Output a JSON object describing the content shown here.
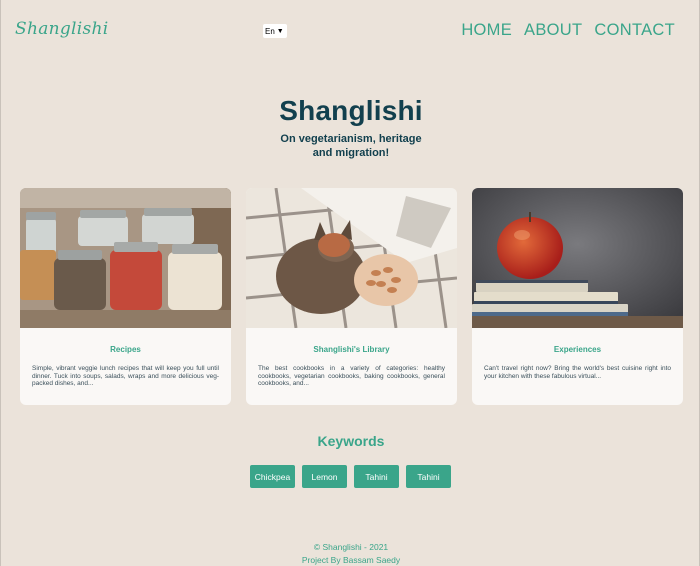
{
  "header": {
    "logo": "Shanglishi",
    "language": "En",
    "nav": [
      "HOME",
      "ABOUT",
      "CONTACT"
    ]
  },
  "hero": {
    "title": "Shanglishi",
    "subtitle": "On vegetarianism, heritage and migration!"
  },
  "cards": [
    {
      "title": "Recipes",
      "text": "Simple, vibrant veggie lunch recipes that will keep you full until dinner. Tuck into soups, salads, wraps and more delicious veg-packed dishes, and...",
      "image": "spice-jars-photo"
    },
    {
      "title": "Shanglishi's Library",
      "text": "The best cookbooks in a variety of categories: healthy cookbooks, vegetarian cookbooks, baking cookbooks, general cookbooks, and...",
      "image": "cat-with-cookbook-photo"
    },
    {
      "title": "Experiences",
      "text": "Can't travel right now? Bring the world's best cuisine right into your kitchen with these fabulous virtual...",
      "image": "apple-on-books-photo"
    }
  ],
  "keywords": {
    "heading": "Keywords",
    "items": [
      "Chickpea",
      "Lemon",
      "Tahini",
      "Tahini"
    ]
  },
  "footer": {
    "copyright": "© Shanglishi - 2021",
    "credit": "Project By Bassam Saedy"
  },
  "colors": {
    "accent": "#3aa58a",
    "title": "#12404e",
    "background": "#ebe3da",
    "card": "#faf8f6"
  }
}
